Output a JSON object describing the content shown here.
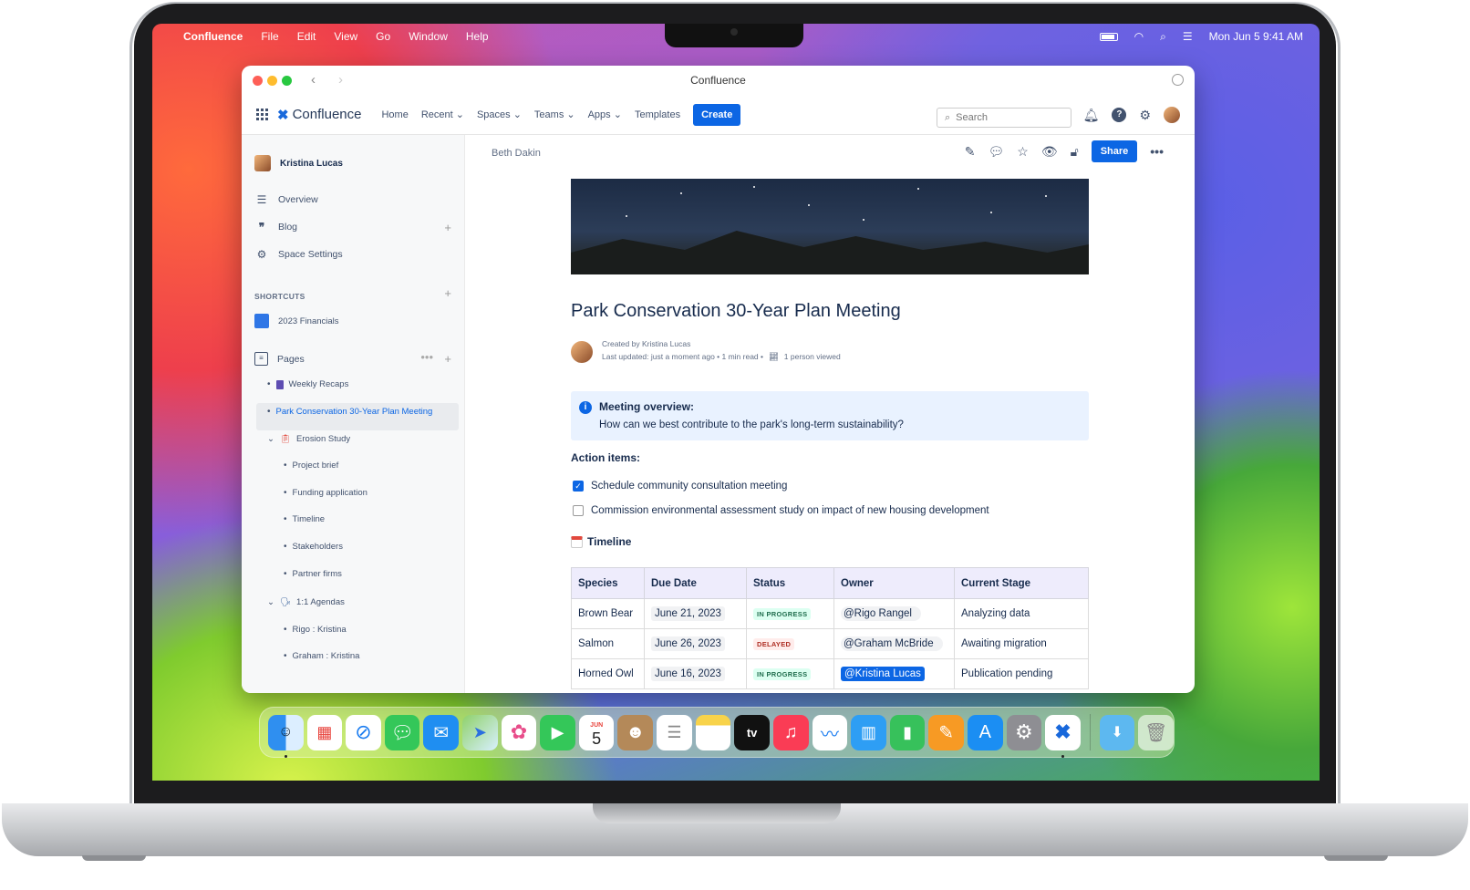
{
  "menubar": {
    "app_name": "Confluence",
    "items": [
      "File",
      "Edit",
      "View",
      "Go",
      "Window",
      "Help"
    ],
    "datetime": "Mon Jun 5  9:41 AM"
  },
  "window": {
    "title": "Confluence"
  },
  "topnav": {
    "logo": "Confluence",
    "items": [
      "Home",
      "Recent ⌄",
      "Spaces ⌄",
      "Teams ⌄",
      "Apps ⌄",
      "Templates"
    ],
    "create_label": "Create",
    "search_placeholder": "Search"
  },
  "sidebar": {
    "user": "Kristina Lucas",
    "nav": [
      "Overview",
      "Blog",
      "Space Settings"
    ],
    "shortcuts_header": "SHORTCUTS",
    "shortcut": "2023 Financials",
    "pages_label": "Pages",
    "tree": [
      "Weekly Recaps",
      "Park Conservation 30-Year Plan Meeting",
      "Erosion Study",
      "Project brief",
      "Funding application",
      "Timeline",
      "Stakeholders",
      "Partner firms",
      "1:1 Agendas",
      "Rigo : Kristina",
      "Graham : Kristina"
    ]
  },
  "page": {
    "breadcrumb": "Beth Dakin",
    "share_label": "Share",
    "title": "Park Conservation 30-Year Plan Meeting",
    "created_by": "Created by Kristina Lucas",
    "last_updated": "Last updated: just a moment ago •   1 min read   •",
    "viewed": "1 person viewed",
    "panel_title": "Meeting overview:",
    "panel_body": "How can we best contribute to the park's long-term sustainability?",
    "action_heading": "Action items:",
    "tasks": [
      {
        "text": "Schedule community consultation meeting",
        "checked": true
      },
      {
        "text": "Commission environmental assessment study on impact of new housing development",
        "checked": false
      }
    ],
    "timeline_heading": "Timeline",
    "table": {
      "headers": [
        "Species",
        "Due Date",
        "Status",
        "Owner",
        "Current Stage"
      ],
      "rows": [
        [
          "Brown Bear",
          "June 21, 2023",
          "IN PROGRESS",
          "@Rigo Rangel",
          "Analyzing data"
        ],
        [
          "Salmon",
          "June 26, 2023",
          "DELAYED",
          "@Graham McBride",
          "Awaiting migration"
        ],
        [
          "Horned Owl",
          "June 16, 2023",
          "IN PROGRESS",
          "@Kristina Lucas",
          "Publication pending"
        ]
      ]
    }
  },
  "dock": {
    "calendar_month": "JUN",
    "calendar_day": "5",
    "tv_label": "tv"
  }
}
